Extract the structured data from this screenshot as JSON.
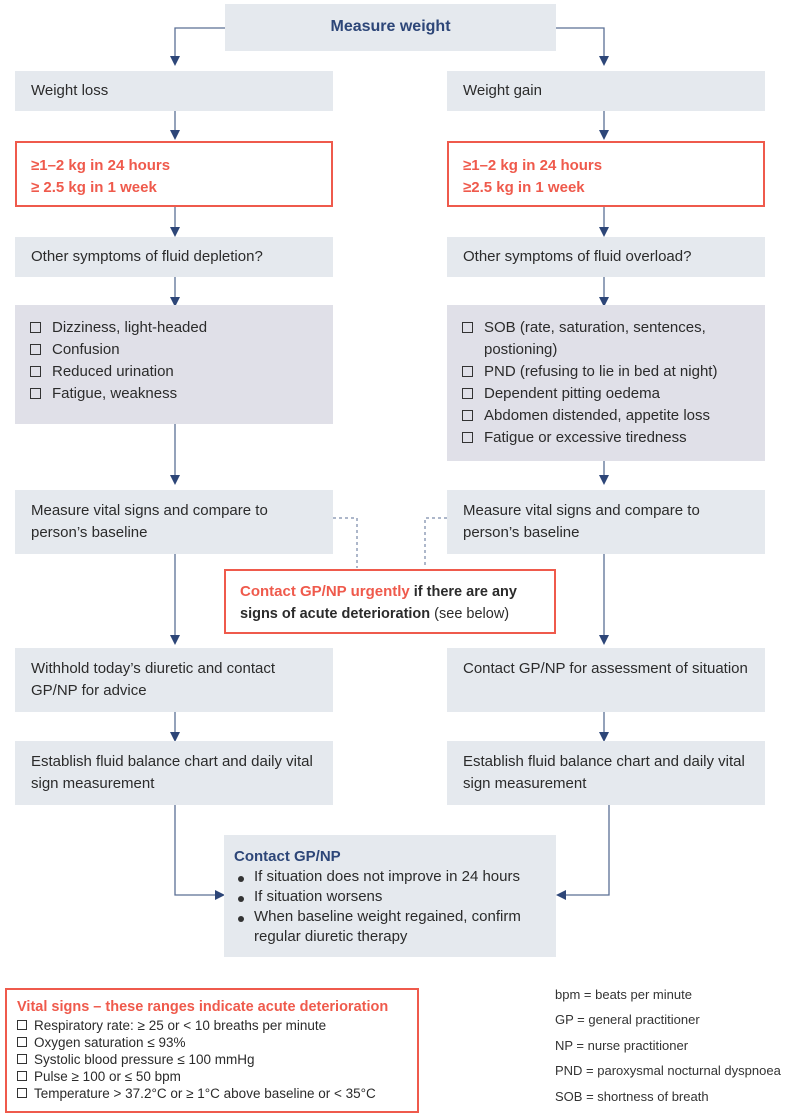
{
  "top": {
    "title": "Measure weight"
  },
  "left": {
    "branch": "Weight loss",
    "criteria": [
      "≥1–2 kg in 24 hours",
      "≥ 2.5 kg in 1 week"
    ],
    "question": "Other symptoms of fluid depletion?",
    "symptoms": [
      "Dizziness, light-headed",
      "Confusion",
      "Reduced urination",
      "Fatigue, weakness"
    ],
    "vitals": "Measure vital signs and compare to person’s baseline",
    "action": "Withhold today’s diuretic and contact GP/NP for advice",
    "balance": "Establish fluid balance chart and daily vital sign measurement"
  },
  "right": {
    "branch": "Weight gain",
    "criteria": [
      "≥1–2 kg in 24 hours",
      "≥2.5 kg in 1 week"
    ],
    "question": "Other symptoms of fluid overload?",
    "symptoms": [
      "SOB (rate, saturation, sentences, postioning)",
      "PND (refusing to lie in bed at night)",
      "Dependent pitting oedema",
      "Abdomen distended, appetite loss",
      "Fatigue or excessive tiredness"
    ],
    "vitals": "Measure vital signs and compare to person’s baseline",
    "action": "Contact GP/NP for assessment of situation",
    "balance": "Establish fluid balance chart and daily vital sign measurement"
  },
  "urgent": {
    "red": "Contact GP/NP urgently",
    "bold": " if there are any signs of acute deterioration",
    "plain": " (see below)"
  },
  "contact": {
    "title": "Contact GP/NP",
    "items": [
      "If situation does not improve in 24 hours",
      "If situation worsens",
      "When baseline weight regained, confirm regular diuretic therapy"
    ]
  },
  "vital_signs": {
    "title": "Vital signs – these ranges indicate acute deterioration",
    "items": [
      "Respiratory rate: ≥ 25 or < 10 breaths per minute",
      "Oxygen saturation ≤ 93%",
      "Systolic blood pressure ≤ 100 mmHg",
      "Pulse ≥ 100 or ≤ 50 bpm",
      "Temperature > 37.2°C or ≥ 1°C above baseline or < 35°C"
    ]
  },
  "abbreviations": [
    "bpm = beats per minute",
    "GP = general practitioner",
    "NP = nurse practitioner",
    "PND = paroxysmal nocturnal dyspnoea",
    "SOB = shortness of breath"
  ],
  "colors": {
    "accent_red": "#ef5a4c",
    "navy": "#2d4678",
    "box_grey": "#e5e9ee",
    "box_purple": "#e0e0e8"
  }
}
